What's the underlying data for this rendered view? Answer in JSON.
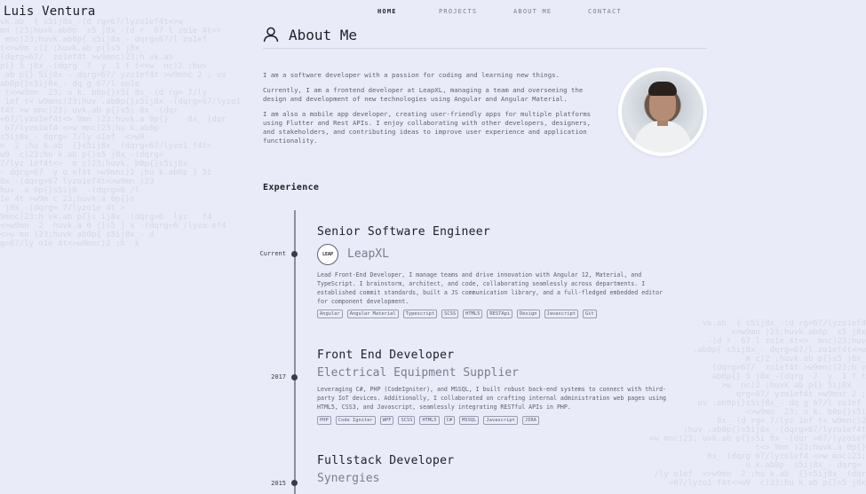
{
  "brand": "Luis Ventura",
  "nav": {
    "home": "HOME",
    "projects": "PROJECTS",
    "about": "ABOUT ME",
    "contact": "CONTACT"
  },
  "about": {
    "title": "About Me",
    "p1": "I am a software developer with a passion for coding and learning new things.",
    "p2": "Currently, I am a frontend developer at LeapXL, managing a team and overseeing the design and development of new technologies using Angular and Angular Material.",
    "p3": "I am also a mobile app developer, creating user-friendly apps for multiple platforms using Flutter and Rest APIs. I enjoy collaborating with other developers, designers, and stakeholders, and contributing ideas to improve user experience and application functionality."
  },
  "experience": {
    "title": "Experience",
    "jobs": [
      {
        "date": "Current",
        "title": "Senior Software Engineer",
        "company": "LeapXL",
        "logo_text": "LEAP",
        "description": "Lead Front-End Developer, I manage teams and drive innovation with Angular 12, Material, and TypeScript. I brainstorm, architect, and code, collaborating seamlessly across departments. I established commit standards, built a JS communication library, and a full-fledged embedded editor for component development.",
        "tags": [
          "Angular",
          "Angular Material",
          "Typescript",
          "SCSS",
          "HTML5",
          "RESTApi",
          "Design",
          "Javascript",
          "Git"
        ]
      },
      {
        "date": "2017",
        "title": "Front End Developer",
        "company": "Electrical Equipment Supplier",
        "description": "Leveraging C#, PHP (CodeIgniter), and MSSQL, I built robust back-end systems to connect with third-party IoT devices. Additionally, I collaborated on crafting internal administration web pages using HTML5, CSS3, and Javascript, seamlessly integrating RESTful APIs in PHP.",
        "tags": [
          "PHP",
          "Code Igniter",
          "WPF",
          "SCSS",
          "HTML5",
          "C#",
          "MSSQL",
          "Javascript",
          "JIRA"
        ]
      },
      {
        "date": "2015",
        "title": "Fullstack Developer",
        "company": "Synergies"
      }
    ]
  }
}
